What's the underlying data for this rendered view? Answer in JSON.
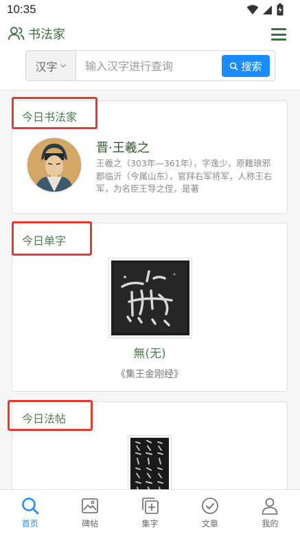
{
  "status_bar": {
    "time": "10:35"
  },
  "app": {
    "title": "书法家"
  },
  "search": {
    "category": "汉字",
    "placeholder": "输入汉字进行查询",
    "button_label": "搜索"
  },
  "today_calligrapher": {
    "section_title": "今日书法家",
    "name": "晋·王羲之",
    "bio": "王羲之（303年—361年），字逸少，原籍琅邪郡临沂（今属山东），官拜右军将军，人称王右军，为名臣王导之侄，是著"
  },
  "today_character": {
    "section_title": "今日单字",
    "character": "無(无)",
    "source": "《集王金刚经》"
  },
  "today_copybook": {
    "section_title": "今日法帖"
  },
  "bottom_nav": {
    "items": [
      {
        "label": "首页",
        "icon": "search-icon",
        "active": true
      },
      {
        "label": "碑帖",
        "icon": "image-icon",
        "active": false
      },
      {
        "label": "集字",
        "icon": "add-square-icon",
        "active": false
      },
      {
        "label": "文章",
        "icon": "check-circle-icon",
        "active": false
      },
      {
        "label": "我的",
        "icon": "user-icon",
        "active": false
      }
    ]
  },
  "colors": {
    "brand_green": "#3d6b3d",
    "accent_blue": "#1a8cff",
    "highlight_red": "#e23a2c"
  }
}
